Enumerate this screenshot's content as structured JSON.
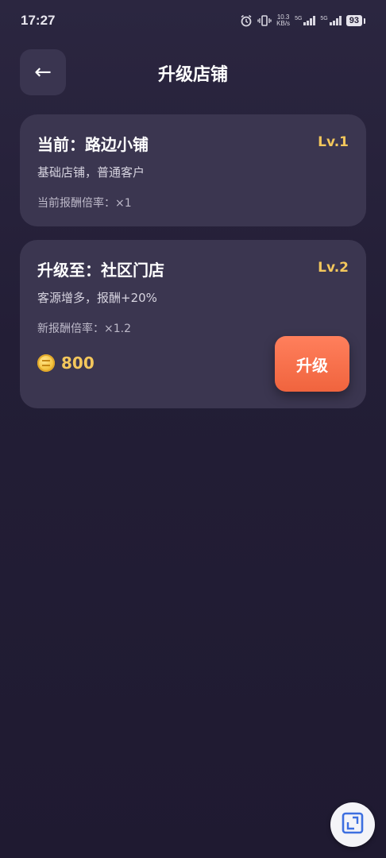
{
  "status_bar": {
    "time": "17:27",
    "net_speed_value": "10.3",
    "net_speed_unit": "KB/s",
    "sim1_label": "5G",
    "sim2_label": "5G",
    "battery": "93"
  },
  "header": {
    "back_glyph": "←",
    "title": "升级店铺"
  },
  "current_shop": {
    "title": "当前：路边小铺",
    "level": "Lv.1",
    "description": "基础店铺，普通客户",
    "rate": "当前报酬倍率：×1"
  },
  "next_shop": {
    "title": "升级至：社区门店",
    "level": "Lv.2",
    "description": "客源增多，报酬+20%",
    "rate": "新报酬倍率：×1.2",
    "cost_icon": "coin-icon",
    "cost": "800",
    "upgrade_label": "升级"
  },
  "colors": {
    "accent_gold": "#f3c75c",
    "upgrade_button": "#f0643e",
    "card_bg": "#3b3650"
  }
}
